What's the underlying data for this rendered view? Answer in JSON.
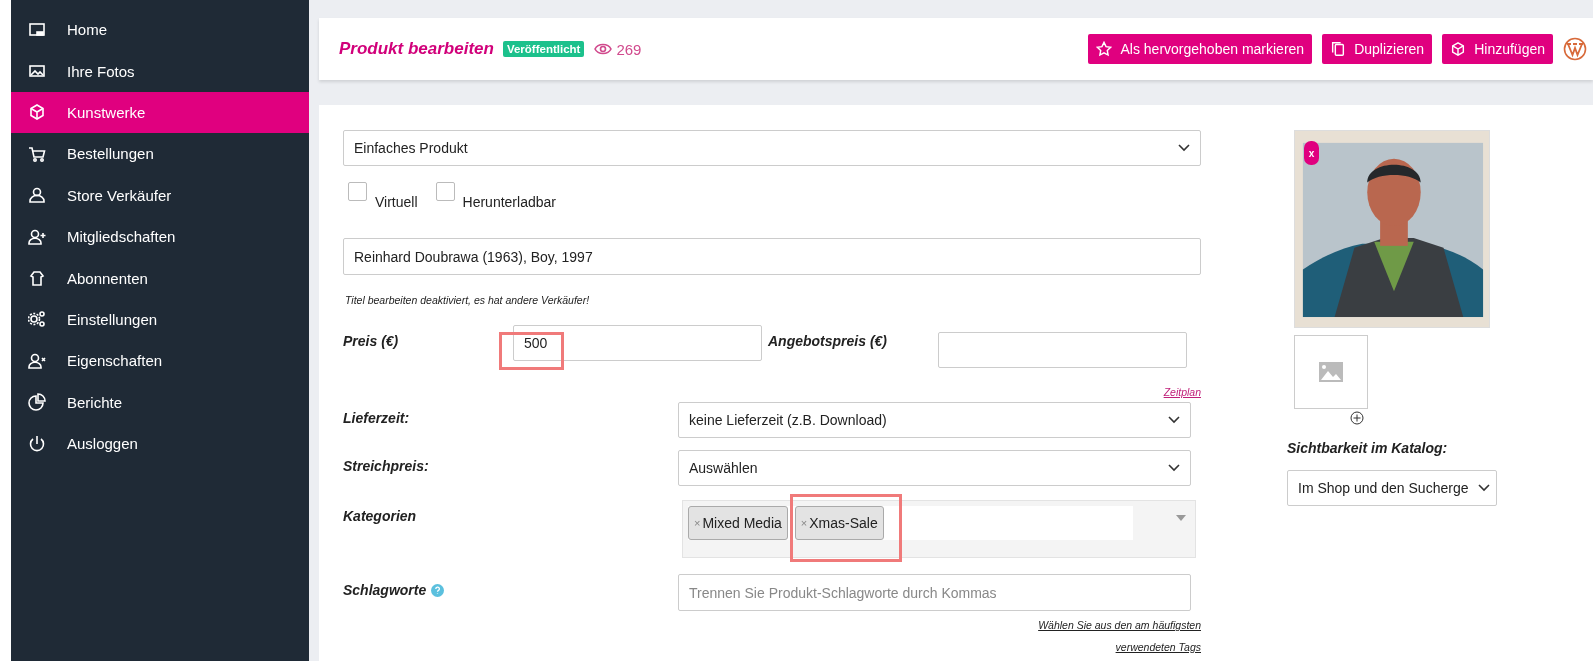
{
  "sidebar": {
    "items": [
      {
        "label": "Home",
        "selected": false
      },
      {
        "label": "Ihre Fotos",
        "selected": false
      },
      {
        "label": "Kunstwerke",
        "selected": true
      },
      {
        "label": "Bestellungen",
        "selected": false
      },
      {
        "label": "Store Verkäufer",
        "selected": false
      },
      {
        "label": "Mitgliedschaften",
        "selected": false
      },
      {
        "label": "Abonnenten",
        "selected": false
      },
      {
        "label": "Einstellungen",
        "selected": false
      },
      {
        "label": "Eigenschaften",
        "selected": false
      },
      {
        "label": "Berichte",
        "selected": false
      },
      {
        "label": "Ausloggen",
        "selected": false
      }
    ]
  },
  "header": {
    "title": "Produkt bearbeiten",
    "status_badge": "Veröffentlicht",
    "views": "269",
    "buttons": [
      {
        "label": "Als hervorgehoben markieren"
      },
      {
        "label": "Duplizieren"
      },
      {
        "label": "Hinzufügen"
      }
    ]
  },
  "form": {
    "product_type": "Einfaches Produkt",
    "checkboxes": [
      {
        "label": "Virtuell",
        "checked": false
      },
      {
        "label": "Herunterladbar",
        "checked": false
      }
    ],
    "title_value": "Reinhard Doubrawa (1963), Boy, 1997",
    "title_note": "Titel bearbeiten deaktiviert, es hat andere Verkäufer!",
    "price": {
      "label": "Preis (€)",
      "value": "500",
      "highlighted": true
    },
    "sale_price": {
      "label": "Angebotspreis (€)"
    },
    "schedule_link": "Zeitplan",
    "delivery": {
      "label": "Lieferzeit:",
      "value": "keine Lieferzeit (z.B. Download)"
    },
    "strike_price": {
      "label": "Streichpreis:",
      "value": "Auswählen"
    },
    "categories": {
      "label": "Kategorien",
      "tags": [
        {
          "label": "Mixed Media",
          "remove_mark": "×",
          "highlighted": false
        },
        {
          "label": "Xmas-Sale",
          "remove_mark": "×",
          "highlighted": true
        }
      ]
    },
    "tags": {
      "label": "Schlagworte",
      "placeholder": "Trennen Sie Produkt-Schlagworte durch Kommas",
      "link": "Wählen Sie aus den am häufigsten verwendeten Tags"
    }
  },
  "media": {
    "remove_label": "x",
    "visibility_label": "Sichtbarkeit im Katalog:",
    "visibility_value": "Im Shop und den Sucherge"
  }
}
